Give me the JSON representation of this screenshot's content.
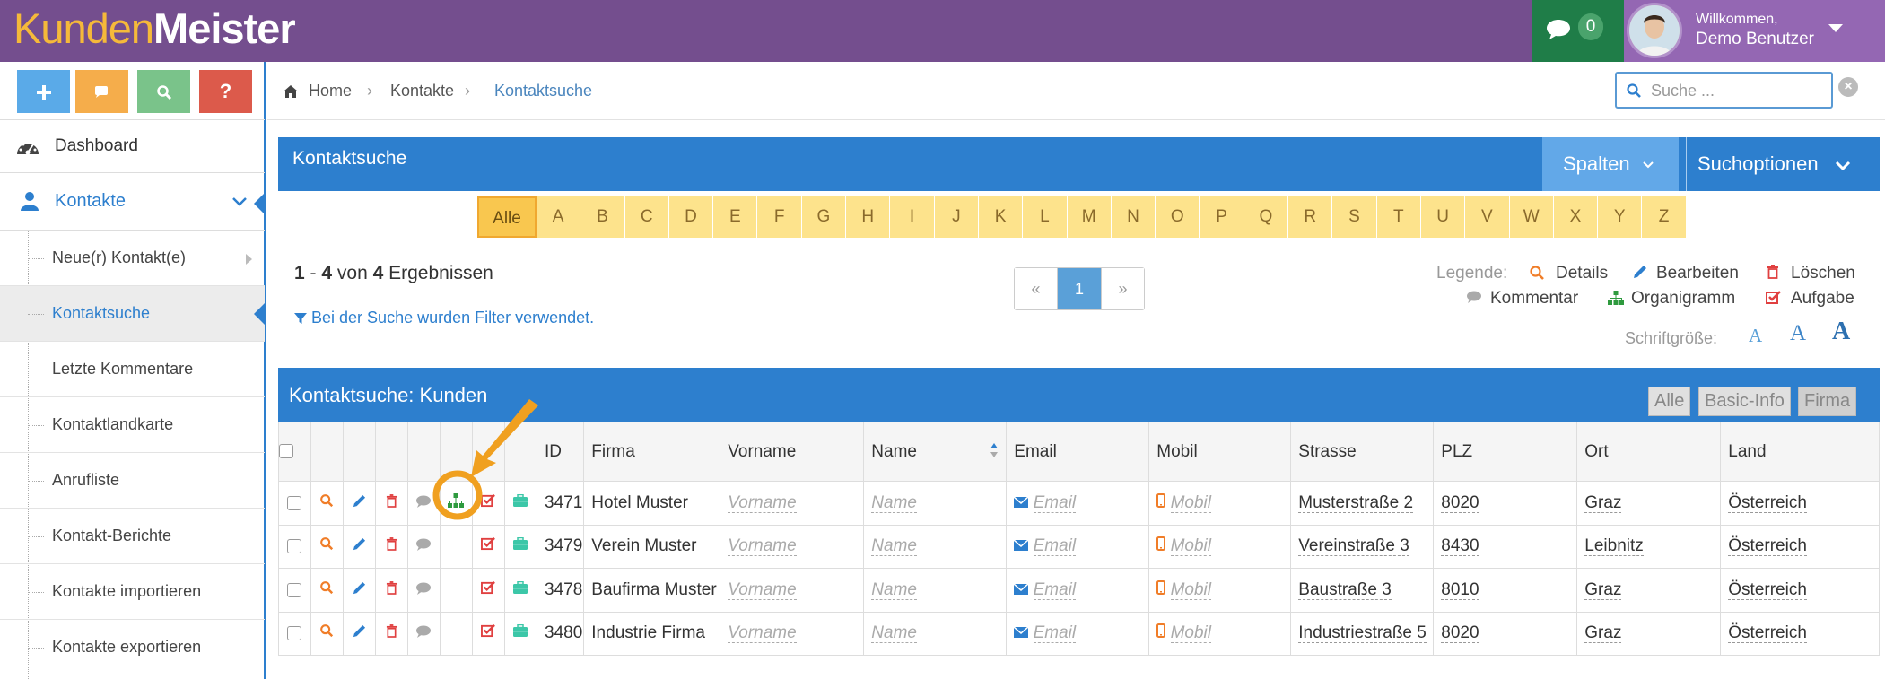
{
  "app": {
    "logo_part1": "Kunden",
    "logo_part2": "Meister"
  },
  "topbar": {
    "chat_count": "0",
    "welcome": "Willkommen,",
    "user": "Demo Benutzer"
  },
  "quick_buttons": [
    "+",
    "",
    "",
    "?"
  ],
  "sidebar": {
    "dashboard": "Dashboard",
    "kontakte": "Kontakte",
    "items": [
      {
        "label": "Neue(r) Kontakt(e)"
      },
      {
        "label": "Kontaktsuche"
      },
      {
        "label": "Letzte Kommentare"
      },
      {
        "label": "Kontaktlandkarte"
      },
      {
        "label": "Anrufliste"
      },
      {
        "label": "Kontakt-Berichte"
      },
      {
        "label": "Kontakte importieren"
      },
      {
        "label": "Kontakte exportieren"
      }
    ]
  },
  "breadcrumb": {
    "home": "Home",
    "kontakte": "Kontakte",
    "current": "Kontaktsuche"
  },
  "search": {
    "placeholder": "Suche ..."
  },
  "panel": {
    "title": "Kontaktsuche",
    "spalten": "Spalten",
    "suchoptionen": "Suchoptionen"
  },
  "alphabet": [
    "Alle",
    "A",
    "B",
    "C",
    "D",
    "E",
    "F",
    "G",
    "H",
    "I",
    "J",
    "K",
    "L",
    "M",
    "N",
    "O",
    "P",
    "Q",
    "R",
    "S",
    "T",
    "U",
    "V",
    "W",
    "X",
    "Y",
    "Z"
  ],
  "results": {
    "from": "1",
    "to": "4",
    "von": "von",
    "total": "4",
    "label": "Ergebnissen",
    "filter_note": "Bei der Suche wurden Filter verwendet."
  },
  "pager": {
    "prev": "«",
    "current": "1",
    "next": "»"
  },
  "legend": {
    "label": "Legende:",
    "details": "Details",
    "bearbeiten": "Bearbeiten",
    "loeschen": "Löschen",
    "kommentar": "Kommentar",
    "organigramm": "Organigramm",
    "aufgabe": "Aufgabe",
    "schriftgroesse": "Schriftgröße:",
    "font_a": "A"
  },
  "table": {
    "title": "Kontaktsuche: Kunden",
    "view_buttons": [
      "Alle",
      "Basic-Info",
      "Firma"
    ],
    "columns": [
      "ID",
      "Firma",
      "Vorname",
      "Name",
      "Email",
      "Mobil",
      "Strasse",
      "PLZ",
      "Ort",
      "Land"
    ],
    "placeholders": {
      "vorname": "Vorname",
      "name": "Name",
      "email": "Email",
      "mobil": "Mobil"
    },
    "rows": [
      {
        "id": "3471",
        "firma": "Hotel Muster",
        "strasse": "Musterstraße 2",
        "plz": "8020",
        "ort": "Graz",
        "land": "Österreich"
      },
      {
        "id": "3479",
        "firma": "Verein Muster",
        "strasse": "Vereinstraße 3",
        "plz": "8430",
        "ort": "Leibnitz",
        "land": "Österreich"
      },
      {
        "id": "3478",
        "firma": "Baufirma Muster",
        "strasse": "Baustraße 3",
        "plz": "8010",
        "ort": "Graz",
        "land": "Österreich"
      },
      {
        "id": "3480",
        "firma": "Industrie Firma",
        "strasse": "Industriestraße 5",
        "plz": "8020",
        "ort": "Graz",
        "land": "Österreich"
      }
    ]
  },
  "colors": {
    "purple": "#744e8e",
    "blue": "#2d7fce",
    "orange_highlight": "#f0a020"
  }
}
